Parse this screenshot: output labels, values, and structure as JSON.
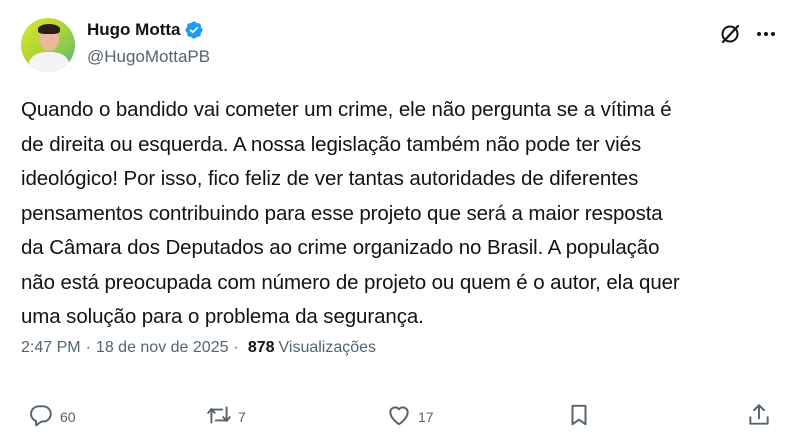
{
  "author": {
    "display_name": "Hugo Motta",
    "handle": "@HugoMottaPB"
  },
  "icons": {
    "verified": "verified-badge-icon",
    "grok": "grok-icon",
    "more": "more-icon",
    "reply": "reply-icon",
    "retweet": "retweet-icon",
    "like": "heart-icon",
    "bookmark": "bookmark-icon",
    "share": "share-icon"
  },
  "tweet": {
    "text": "Quando o bandido vai cometer um crime, ele não pergunta se a vítima é\nde direita ou esquerda. A nossa legislação também não pode ter viés\nideológico! Por isso, fico feliz de ver tantas autoridades de diferentes\npensamentos contribuindo para esse projeto que será a maior resposta\nda Câmara dos Deputados ao crime organizado no Brasil. A população\nnão está preocupada com número de projeto ou quem é o autor, ela quer\numa solução para o problema da segurança.",
    "time": "2:47 PM",
    "date": "18 de nov de 2025",
    "views_count": "878",
    "views_label": "Visualizações"
  },
  "actions": {
    "replies": "60",
    "retweets": "7",
    "likes": "17"
  },
  "colors": {
    "verified_blue": "#1d9bf0",
    "secondary_text": "#536471",
    "primary_text": "#0f1419"
  }
}
